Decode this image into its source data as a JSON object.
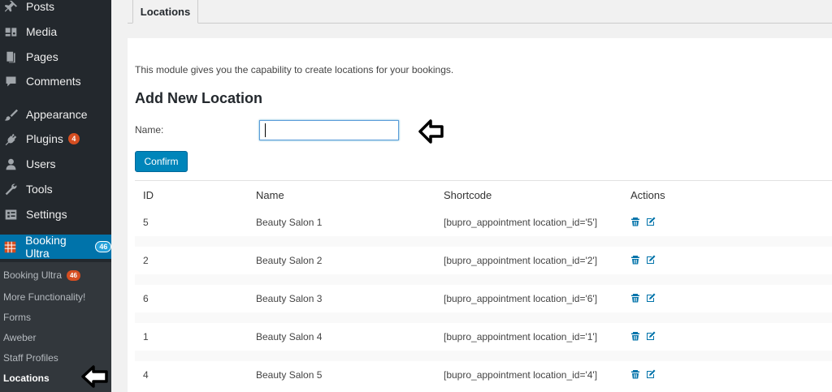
{
  "sidebar": {
    "items": [
      {
        "label": "Posts",
        "icon": "pin-icon"
      },
      {
        "label": "Media",
        "icon": "media-icon"
      },
      {
        "label": "Pages",
        "icon": "pages-icon"
      },
      {
        "label": "Comments",
        "icon": "comments-icon"
      },
      {
        "label": "Appearance",
        "icon": "paintbrush-icon"
      },
      {
        "label": "Plugins",
        "icon": "plugins-icon",
        "count": "4"
      },
      {
        "label": "Users",
        "icon": "users-icon"
      },
      {
        "label": "Tools",
        "icon": "wrench-icon"
      },
      {
        "label": "Settings",
        "icon": "settings-icon"
      },
      {
        "label": "Booking Ultra",
        "icon": "calendar-grid-icon",
        "count": "46"
      }
    ],
    "submenu": [
      {
        "label": "Booking Ultra",
        "count": "46"
      },
      {
        "label": "More Functionality!"
      },
      {
        "label": "Forms"
      },
      {
        "label": "Aweber"
      },
      {
        "label": "Staff Profiles"
      },
      {
        "label": "Locations"
      }
    ]
  },
  "tab": {
    "label": "Locations"
  },
  "main": {
    "description": "This module gives you the capability to create locations for your bookings.",
    "heading": "Add New Location",
    "name_label": "Name:",
    "name_value": "",
    "confirm_label": "Confirm"
  },
  "table": {
    "headers": {
      "id": "ID",
      "name": "Name",
      "shortcode": "Shortcode",
      "actions": "Actions"
    },
    "rows": [
      {
        "id": "5",
        "name": "Beauty Salon 1",
        "shortcode": "[bupro_appointment location_id='5']"
      },
      {
        "id": "2",
        "name": "Beauty Salon 2",
        "shortcode": "[bupro_appointment location_id='2']"
      },
      {
        "id": "6",
        "name": "Beauty Salon 3",
        "shortcode": "[bupro_appointment location_id='6']"
      },
      {
        "id": "1",
        "name": "Beauty Salon 4",
        "shortcode": "[bupro_appointment location_id='1']"
      },
      {
        "id": "4",
        "name": "Beauty Salon 5",
        "shortcode": "[bupro_appointment location_id='4']"
      }
    ]
  },
  "colors": {
    "sidebar_bg": "#23282d",
    "active_menu": "#0073aa",
    "badge": "#d54e21",
    "action_icon": "#0073aa"
  }
}
